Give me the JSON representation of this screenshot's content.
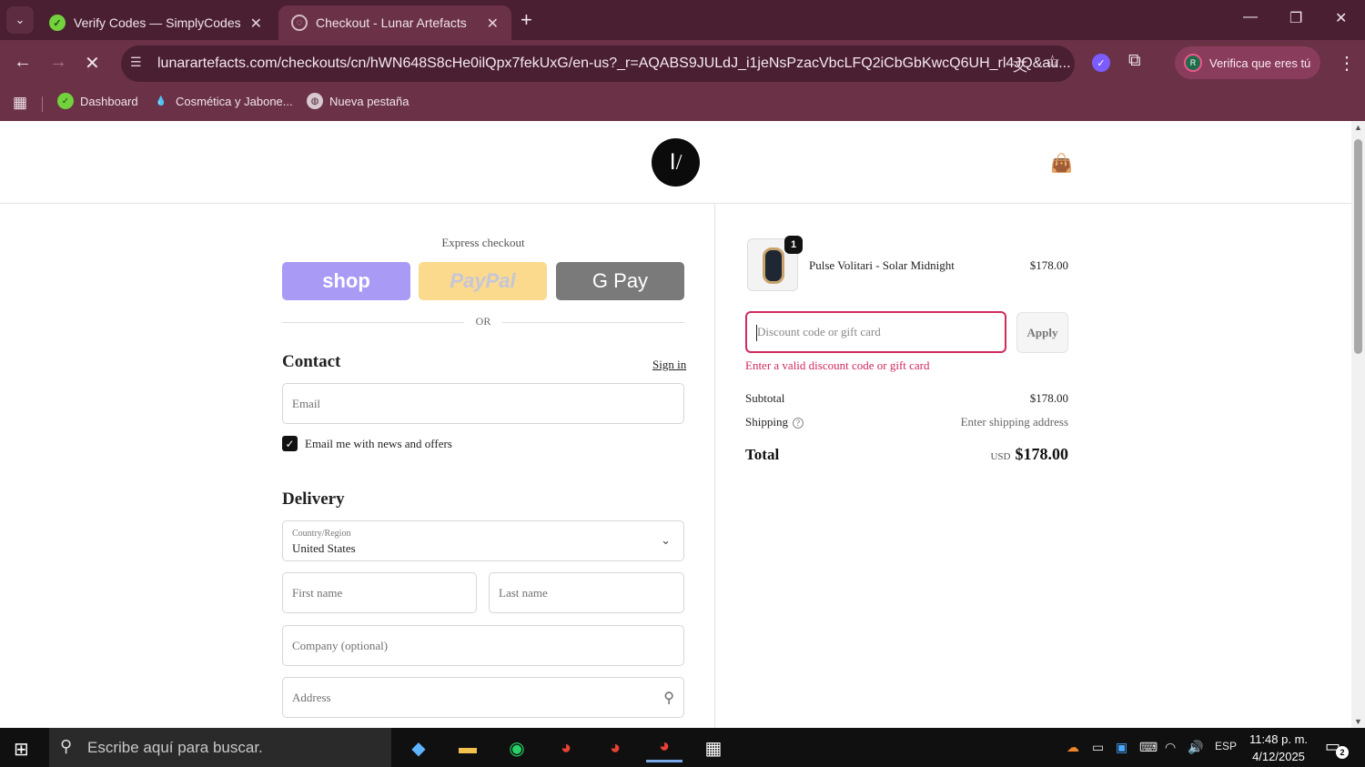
{
  "browser": {
    "tabs": [
      {
        "title": "Verify Codes — SimplyCodes",
        "active": false
      },
      {
        "title": "Checkout - Lunar Artefacts",
        "active": true
      }
    ],
    "url": "lunarartefacts.com/checkouts/cn/hWN648S8cHe0ilQpx7fekUxG/en-us?_r=AQABS9JULdJ_i1jeNsPzacVbcLFQ2iCbGbKwcQ6UH_rl4JQ&au...",
    "profile_label": "Verifica que eres tú",
    "profile_initial": "R",
    "bookmarks": [
      {
        "label": "Dashboard"
      },
      {
        "label": "Cosmética y Jabone..."
      },
      {
        "label": "Nueva pestaña"
      }
    ],
    "accent": "#4a1f32"
  },
  "store": {
    "logo_glyph": "Ⅰ/"
  },
  "checkout": {
    "express_label": "Express checkout",
    "express_buttons": {
      "shop": "shop",
      "paypal": "PayPal",
      "gpay": "G Pay"
    },
    "or_label": "OR",
    "contact_heading": "Contact",
    "sign_in": "Sign in",
    "email_placeholder": "Email",
    "newsletter_label": "Email me with news and offers",
    "newsletter_checked": true,
    "delivery_heading": "Delivery",
    "country_label": "Country/Region",
    "country_value": "United States",
    "first_name_placeholder": "First name",
    "last_name_placeholder": "Last name",
    "company_placeholder": "Company (optional)",
    "address_placeholder": "Address"
  },
  "summary": {
    "item": {
      "name": "Pulse Volitari - Solar Midnight",
      "price": "$178.00",
      "quantity": "1"
    },
    "discount_placeholder": "Discount code or gift card",
    "apply_label": "Apply",
    "error": "Enter a valid discount code or gift card",
    "subtotal_label": "Subtotal",
    "subtotal_value": "$178.00",
    "shipping_label": "Shipping",
    "shipping_value": "Enter shipping address",
    "total_label": "Total",
    "currency": "USD",
    "total_value": "$178.00",
    "error_color": "#d12a5c"
  },
  "taskbar": {
    "search_placeholder": "Escribe aquí para buscar.",
    "language": "ESP",
    "time": "11:48 p. m.",
    "date": "4/12/2025",
    "notifications": "2"
  }
}
